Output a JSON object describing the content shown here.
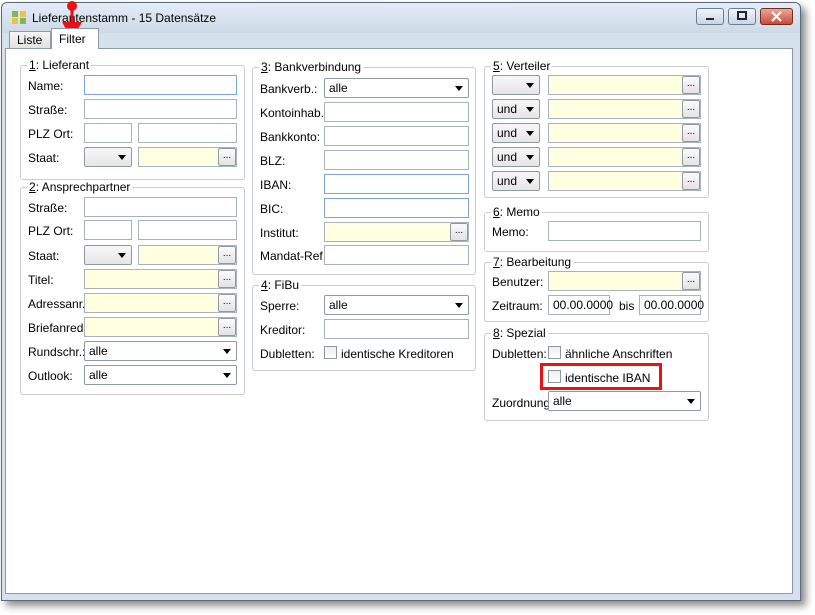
{
  "window": {
    "title": "Lieferantenstamm - 15 Datensätze",
    "controls": {
      "minimize": "minimize",
      "maximize": "maximize",
      "close": "close"
    }
  },
  "tabs": [
    {
      "label": "Liste"
    },
    {
      "label": "Filter",
      "active": true
    }
  ],
  "annotation": {
    "color": "#ee1111",
    "arrow_target": "tab-filter",
    "highlight_target": "identische IBAN"
  },
  "lieferant": {
    "num": "1",
    "legend": ": Lieferant",
    "name_label": "Name:",
    "strasse_label": "Straße:",
    "plz_label": "PLZ Ort:",
    "staat_label": "Staat:",
    "staat_value": "",
    "dots": "..."
  },
  "ansprechpartner": {
    "num": "2",
    "legend": ": Ansprechpartner",
    "strasse_label": "Straße:",
    "plz_label": "PLZ Ort:",
    "staat_label": "Staat:",
    "titel_label": "Titel:",
    "adressanr_label": "Adressanr.:",
    "briefanr_label": "Briefanred.:",
    "rundschr_label": "Rundschr.:",
    "rundschr_value": "alle",
    "outlook_label": "Outlook:",
    "outlook_value": "alle",
    "dots": "..."
  },
  "bank": {
    "num": "3",
    "legend": ": Bankverbindung",
    "bankverb_label": "Bankverb.:",
    "bankverb_value": "alle",
    "kontoinhab_label": "Kontoinhab.:",
    "bankkonto_label": "Bankkonto:",
    "blz_label": "BLZ:",
    "iban_label": "IBAN:",
    "bic_label": "BIC:",
    "institut_label": "Institut:",
    "mandat_label": "Mandat-Ref.:",
    "dots": "..."
  },
  "fibu": {
    "num": "4",
    "legend": ": FiBu",
    "sperre_label": "Sperre:",
    "sperre_value": "alle",
    "kreditor_label": "Kreditor:",
    "dubletten_label": "Dubletten:",
    "identische_kreditoren": "identische Kreditoren"
  },
  "verteiler": {
    "num": "5",
    "legend": ": Verteiler",
    "rows": [
      {
        "op": ""
      },
      {
        "op": "und"
      },
      {
        "op": "und"
      },
      {
        "op": "und"
      },
      {
        "op": "und"
      }
    ],
    "dots": "..."
  },
  "memo": {
    "num": "6",
    "legend": ": Memo",
    "memo_label": "Memo:"
  },
  "bearbeitung": {
    "num": "7",
    "legend": ": Bearbeitung",
    "benutzer_label": "Benutzer:",
    "zeitraum_label": "Zeitraum:",
    "von": "00.00.0000",
    "bis_label": "bis",
    "bis": "00.00.0000",
    "dots": "..."
  },
  "spezial": {
    "num": "8",
    "legend": ": Spezial",
    "dubletten_label": "Dubletten:",
    "aehnliche_anschriften": "ähnliche Anschriften",
    "identische_iban": "identische IBAN",
    "zuordnung_label": "Zuordnung:",
    "zuordnung_value": "alle"
  }
}
